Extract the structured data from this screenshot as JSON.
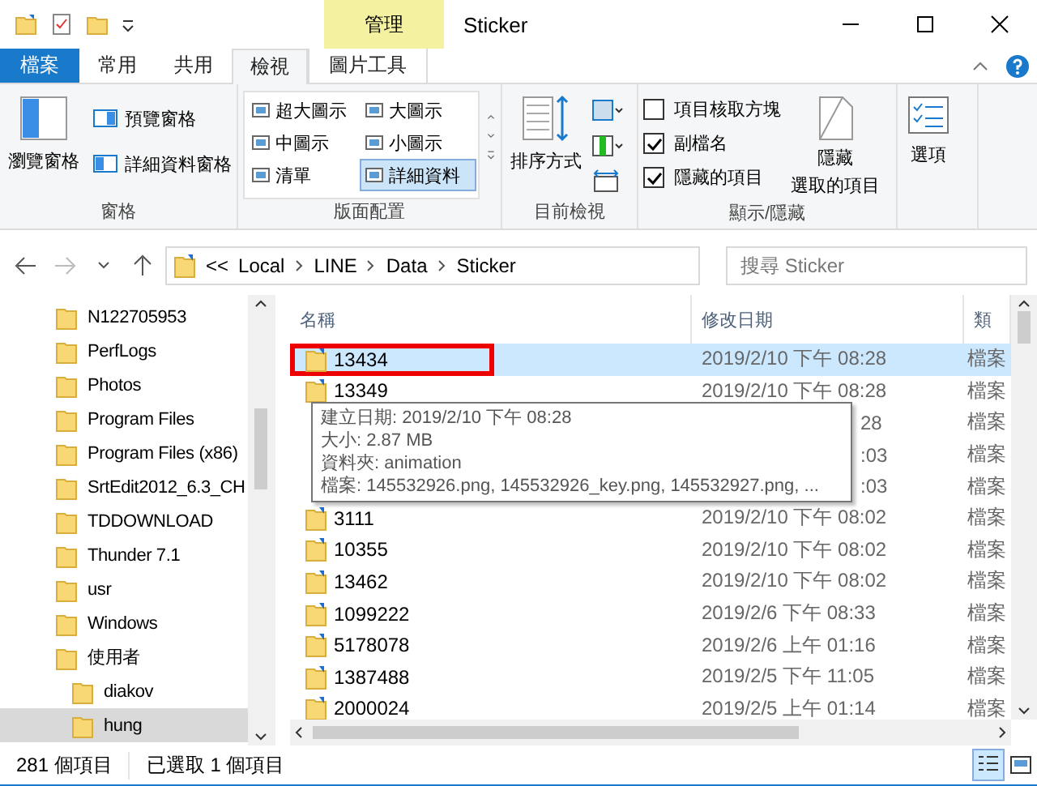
{
  "window": {
    "title": "Sticker",
    "context_group": "管理"
  },
  "ribbon_tabs": [
    {
      "label": "檔案",
      "kind": "file",
      "selected": false
    },
    {
      "label": "常用",
      "kind": "tab",
      "selected": false
    },
    {
      "label": "共用",
      "kind": "tab",
      "selected": false
    },
    {
      "label": "檢視",
      "kind": "tab",
      "selected": true
    },
    {
      "label": "圖片工具",
      "kind": "context",
      "selected": false
    }
  ],
  "panes_group": {
    "label": "窗格",
    "navigation": "瀏覽窗格",
    "preview": "預覽窗格",
    "details": "詳細資料窗格"
  },
  "layout_group": {
    "label": "版面配置",
    "options": [
      {
        "label": "超大圖示",
        "selected": false
      },
      {
        "label": "大圖示",
        "selected": false
      },
      {
        "label": "中圖示",
        "selected": false
      },
      {
        "label": "小圖示",
        "selected": false
      },
      {
        "label": "清單",
        "selected": false
      },
      {
        "label": "詳細資料",
        "selected": true
      }
    ]
  },
  "view_group": {
    "label": "目前檢視",
    "sort": "排序方式"
  },
  "show_group": {
    "label": "顯示/隱藏",
    "checks": [
      {
        "label": "項目核取方塊",
        "checked": false
      },
      {
        "label": "副檔名",
        "checked": true
      },
      {
        "label": "隱藏的項目",
        "checked": true
      }
    ],
    "hide_selected": [
      "隱藏",
      "選取的項目"
    ]
  },
  "options_group": {
    "label": "選項"
  },
  "address": {
    "overflow": "<<",
    "path": [
      "Local",
      "LINE",
      "Data",
      "Sticker"
    ],
    "search_placeholder": "搜尋 Sticker"
  },
  "nav_tree": [
    {
      "label": "N122705953"
    },
    {
      "label": "PerfLogs"
    },
    {
      "label": "Photos"
    },
    {
      "label": "Program Files"
    },
    {
      "label": "Program Files (x86)"
    },
    {
      "label": "SrtEdit2012_6.3_CH"
    },
    {
      "label": "TDDOWNLOAD"
    },
    {
      "label": "Thunder 7.1"
    },
    {
      "label": "usr"
    },
    {
      "label": "Windows"
    },
    {
      "label": "使用者",
      "children": [
        {
          "label": "diakov",
          "selected": false
        },
        {
          "label": "hung",
          "selected": true
        }
      ]
    }
  ],
  "files": {
    "columns": [
      "名稱",
      "修改日期",
      "類"
    ],
    "rows": [
      {
        "name": "13434",
        "modified": "2019/2/10 下午 08:28",
        "type": "檔案",
        "selected": true,
        "highlighted": true
      },
      {
        "name": "13349",
        "modified": "2019/2/10 下午 08:28",
        "type": "檔案",
        "selected": false,
        "highlighted": false
      },
      {
        "kind": "covered",
        "modified": "28",
        "type": "檔案",
        "selected": false,
        "highlighted": false
      },
      {
        "kind": "covered",
        "modified": ":03",
        "type": "檔案",
        "selected": false,
        "highlighted": false
      },
      {
        "kind": "covered",
        "modified": ":03",
        "type": "檔案",
        "selected": false,
        "highlighted": false
      },
      {
        "name": "3111",
        "modified": "2019/2/10 下午 08:02",
        "type": "檔案",
        "selected": false,
        "highlighted": false
      },
      {
        "name": "10355",
        "modified": "2019/2/10 下午 08:02",
        "type": "檔案",
        "selected": false,
        "highlighted": false
      },
      {
        "name": "13462",
        "modified": "2019/2/10 下午 08:02",
        "type": "檔案",
        "selected": false,
        "highlighted": false
      },
      {
        "name": "1099222",
        "modified": "2019/2/6 下午 08:33",
        "type": "檔案",
        "selected": false,
        "highlighted": false
      },
      {
        "name": "5178078",
        "modified": "2019/2/6 上午 01:16",
        "type": "檔案",
        "selected": false,
        "highlighted": false
      },
      {
        "name": "1387488",
        "modified": "2019/2/5 下午 11:05",
        "type": "檔案",
        "selected": false,
        "highlighted": false
      },
      {
        "name": "2000024",
        "modified": "2019/2/5 上午 01:14",
        "type": "檔案",
        "selected": false,
        "highlighted": false
      }
    ]
  },
  "tooltip": [
    "建立日期: 2019/2/10 下午 08:28",
    "大小: 2.87 MB",
    "資料夾: animation",
    "檔案: 145532926.png, 145532926_key.png, 145532927.png, ..."
  ],
  "status_bar": [
    "281 個項目",
    "已選取 1 個項目"
  ]
}
